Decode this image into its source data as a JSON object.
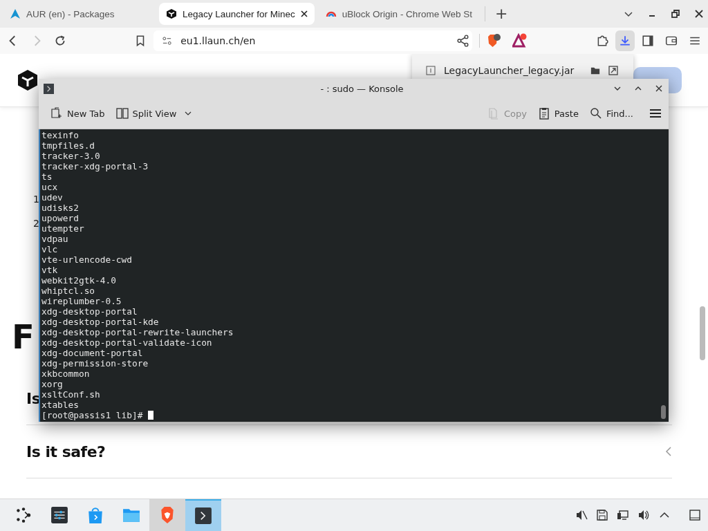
{
  "browser": {
    "tabs": [
      {
        "title": "AUR (en) - Packages",
        "selected": false
      },
      {
        "title": "Legacy Launcher for Minec",
        "selected": true
      },
      {
        "title": "uBlock Origin - Chrome Web St",
        "selected": false
      }
    ],
    "new_tab": "+",
    "address": "eu1.llaun.ch/en",
    "downloads": [
      {
        "file": "LegacyLauncher_legacy.jar"
      }
    ]
  },
  "page": {
    "list_numbers": [
      "1",
      "2"
    ],
    "faq_heading": "F",
    "faq_items": [
      {
        "question": "Is"
      },
      {
        "question": "Is it safe?"
      }
    ]
  },
  "konsole": {
    "title": "- : sudo — Konsole",
    "toolbar": [
      {
        "kind": "newtab",
        "label": "New Tab",
        "disabled": false
      },
      {
        "kind": "split",
        "label": "Split View",
        "disabled": false
      },
      {
        "kind": "copy",
        "label": "Copy",
        "disabled": true
      },
      {
        "kind": "paste",
        "label": "Paste",
        "disabled": false
      },
      {
        "kind": "find",
        "label": "Find...",
        "disabled": false
      }
    ],
    "lines": [
      "texinfo",
      "tmpfiles.d",
      "tracker-3.0",
      "tracker-xdg-portal-3",
      "ts",
      "ucx",
      "udev",
      "udisks2",
      "upowerd",
      "utempter",
      "vdpau",
      "vlc",
      "vte-urlencode-cwd",
      "vtk",
      "webkit2gtk-4.0",
      "whiptcl.so",
      "wireplumber-0.5",
      "xdg-desktop-portal",
      "xdg-desktop-portal-kde",
      "xdg-desktop-portal-rewrite-launchers",
      "xdg-desktop-portal-validate-icon",
      "xdg-document-portal",
      "xdg-permission-store",
      "xkbcommon",
      "xorg",
      "xsltConf.sh",
      "xtables"
    ],
    "prompt": "[root@passis1 lib]# "
  },
  "taskbar": {
    "apps": [
      {
        "kind": "launcher",
        "selected": false
      },
      {
        "kind": "settings",
        "selected": false
      },
      {
        "kind": "store",
        "selected": false
      },
      {
        "kind": "files",
        "selected": false
      },
      {
        "kind": "browser",
        "selected": false
      },
      {
        "kind": "terminal",
        "selected": true
      }
    ]
  }
}
